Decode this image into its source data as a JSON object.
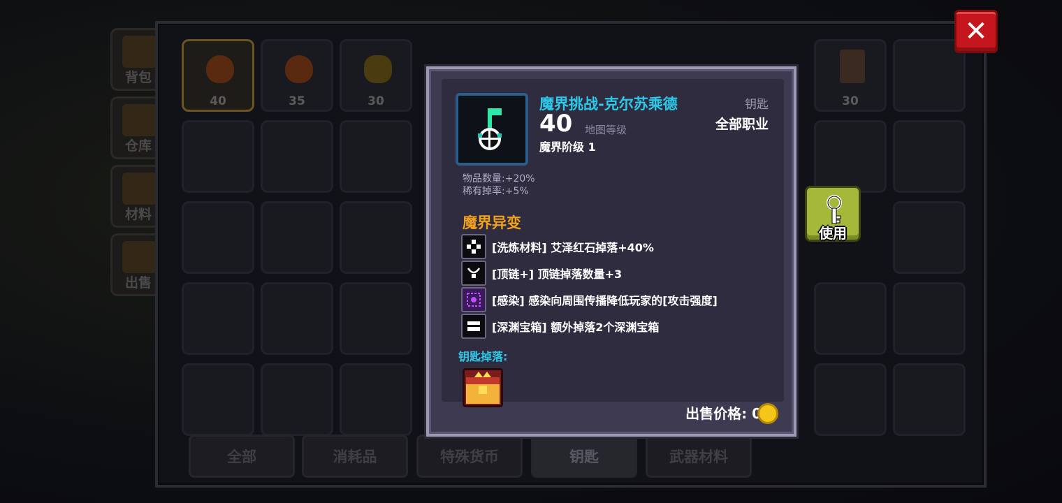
{
  "sidebar": {
    "tabs": [
      {
        "label": "背包"
      },
      {
        "label": "仓库"
      },
      {
        "label": "材料"
      },
      {
        "label": "出售"
      }
    ]
  },
  "inventory": {
    "slots_row1": [
      {
        "count": "40",
        "icon": "demon-heart-icon"
      },
      {
        "count": "35",
        "icon": "demon-heart-icon"
      },
      {
        "count": "30",
        "icon": "bee-key-icon"
      },
      {
        "count": "",
        "icon": "green-flag-key-icon"
      },
      {
        "count": "",
        "icon": "teal-flag-key-icon"
      },
      {
        "count": "",
        "icon": "pink-flag-key-icon"
      },
      {
        "count": "",
        "icon": "gray-flag-key-icon"
      },
      {
        "count": "",
        "icon": "gray-flag-key-icon"
      },
      {
        "count": "30",
        "icon": "totem-key-icon"
      }
    ]
  },
  "categories": [
    {
      "label": "全部"
    },
    {
      "label": "消耗品"
    },
    {
      "label": "特殊货币"
    },
    {
      "label": "钥匙",
      "active": true
    },
    {
      "label": "武器材料"
    }
  ],
  "tooltip": {
    "title": "魔界挑战-克尔苏乘德",
    "type": "钥匙",
    "level": "40",
    "level_label": "地图等级",
    "class": "全部职业",
    "tier": "魔界阶级 1",
    "stats": [
      "物品数量:+20%",
      "稀有掉率:+5%"
    ],
    "mods_title": "魔界异变",
    "mods": [
      {
        "icon": "gear-icon",
        "text": "[洗炼材料] 艾泽红石掉落+40%"
      },
      {
        "icon": "necklace-icon",
        "text": "[顶链+] 顶链掉落数量+3"
      },
      {
        "icon": "virus-icon",
        "text": "[感染] 感染向周围传播降低玩家的[攻击强度]"
      },
      {
        "icon": "chest-icon",
        "text": "[深渊宝箱] 额外掉落2个深渊宝箱"
      }
    ],
    "drops_title": "钥匙掉落:",
    "sell_label": "出售价格: 0"
  },
  "use_button": {
    "label": "使用"
  },
  "colors": {
    "title_cyan": "#2ec8e8",
    "section_orange": "#f0a21c",
    "close_red": "#c4161c",
    "use_green": "#a5b83a"
  }
}
